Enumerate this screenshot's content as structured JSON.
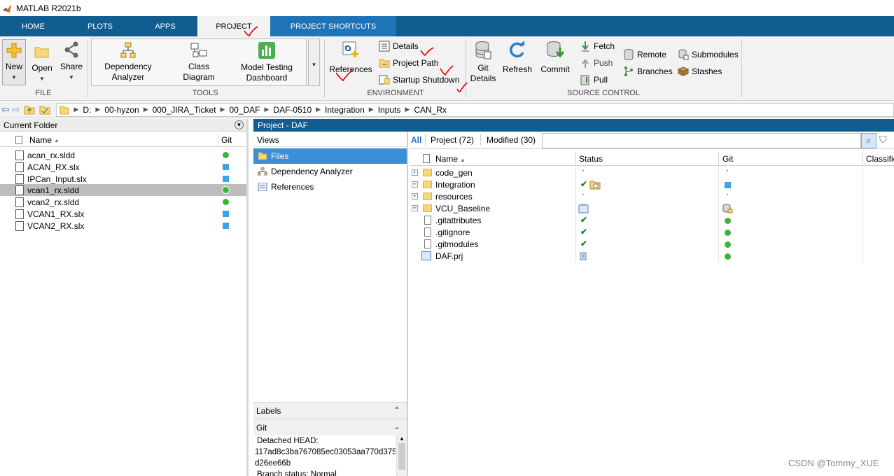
{
  "window": {
    "title": "MATLAB R2021b"
  },
  "tabs": [
    "HOME",
    "PLOTS",
    "APPS",
    "PROJECT",
    "PROJECT SHORTCUTS"
  ],
  "ribbon": {
    "file": {
      "label": "FILE",
      "new": "New",
      "open": "Open",
      "share": "Share"
    },
    "tools": {
      "label": "TOOLS",
      "dep1": "Dependency",
      "dep2": "Analyzer",
      "cls1": "Class",
      "cls2": "Diagram",
      "mt1": "Model Testing",
      "mt2": "Dashboard"
    },
    "environment": {
      "label": "ENVIRONMENT",
      "references": "References",
      "details": "Details",
      "project_path": "Project Path",
      "startup_shutdown": "Startup Shutdown"
    },
    "source_control": {
      "label": "SOURCE CONTROL",
      "git1": "Git",
      "git2": "Details",
      "refresh": "Refresh",
      "commit": "Commit",
      "fetch": "Fetch",
      "push": "Push",
      "pull": "Pull",
      "remote": "Remote",
      "branches": "Branches",
      "submodules": "Submodules",
      "stashes": "Stashes"
    }
  },
  "address": [
    "D:",
    "00-hyzon",
    "000_JIRA_Ticket",
    "00_DAF",
    "DAF-0510",
    "Integration",
    "Inputs",
    "CAN_Rx"
  ],
  "current_folder": {
    "title": "Current Folder",
    "col_name": "Name",
    "col_git": "Git",
    "files": [
      {
        "name": "acan_rx.sldd",
        "git": "dot"
      },
      {
        "name": "ACAN_RX.slx",
        "git": "sq"
      },
      {
        "name": "IPCan_Input.slx",
        "git": "sq"
      },
      {
        "name": "vcan1_rx.sldd",
        "git": "dot"
      },
      {
        "name": "vcan2_rx.sldd",
        "git": "dot"
      },
      {
        "name": "VCAN1_RX.slx",
        "git": "sq"
      },
      {
        "name": "VCAN2_RX.slx",
        "git": "sq"
      }
    ]
  },
  "project": {
    "title": "Project - DAF",
    "views_label": "Views",
    "views": [
      "Files",
      "Dependency Analyzer",
      "References"
    ],
    "labels_label": "Labels",
    "git_label": "Git",
    "git_info": [
      "Detached HEAD:",
      "117ad8c3ba767085ec03053aa770d375",
      "d26ee66b",
      "Branch status: Normal"
    ],
    "filter_tabs": [
      "All",
      "Project (72)",
      "Modified (30)"
    ],
    "columns": [
      "Name",
      "Status",
      "Git",
      "Classific"
    ],
    "rows": [
      {
        "name": "code_gen",
        "kind": "folder"
      },
      {
        "name": "Integration",
        "kind": "folder"
      },
      {
        "name": "resources",
        "kind": "folder"
      },
      {
        "name": "VCU_Baseline",
        "kind": "folder"
      },
      {
        "name": ".gitattributes",
        "kind": "file"
      },
      {
        "name": ".gitignore",
        "kind": "file"
      },
      {
        "name": ".gitmodules",
        "kind": "file"
      },
      {
        "name": "DAF.prj",
        "kind": "prj"
      }
    ]
  },
  "watermark": "CSDN @Tommy_XUE",
  "colors": {
    "tabbar": "#125d8f",
    "selected": "#3b8ed8",
    "git_green": "#3cb43c",
    "git_blue": "#3ea3e6",
    "annotation": "#e00000"
  }
}
